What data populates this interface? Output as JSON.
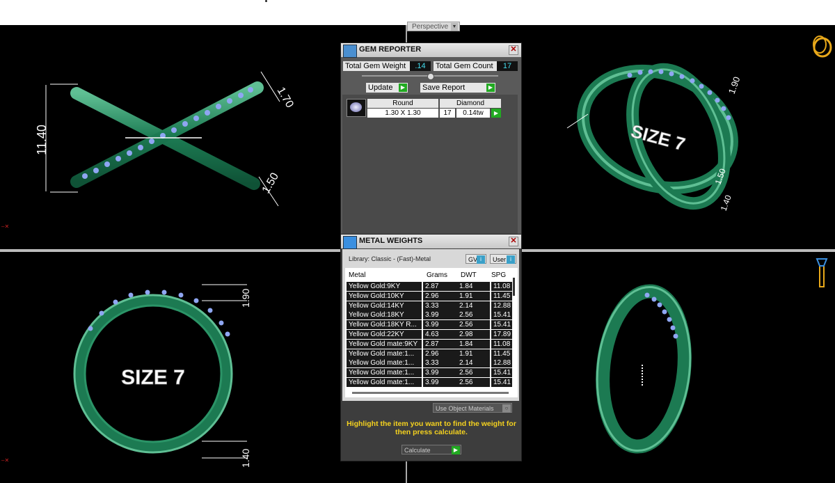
{
  "viewport": {
    "label": "Perspective"
  },
  "views": {
    "size_label": "SIZE 7",
    "dims": [
      "11.40",
      "1.70",
      "1.50",
      "1.90",
      "1.50",
      "1.40",
      "1.90",
      "1.40"
    ]
  },
  "gem_reporter": {
    "title": "GEM REPORTER",
    "total_weight_label": "Total Gem Weight",
    "total_weight_value": ".14",
    "total_count_label": "Total Gem Count",
    "total_count_value": "17",
    "update_label": "Update",
    "save_label": "Save Report",
    "table": {
      "shape": "Round",
      "type": "Diamond",
      "size": "1.30 X 1.30",
      "count": "17",
      "weight": "0.14tw"
    }
  },
  "metal_weights": {
    "title": "METAL WEIGHTS",
    "library": "Library: Classic - (Fast)-Metal",
    "gv_label": "GV",
    "user_label": "User",
    "columns": [
      "Metal",
      "Grams",
      "DWT",
      "SPG"
    ],
    "rows": [
      [
        "Yellow Gold:9KY",
        "2.87",
        "1.84",
        "11.08"
      ],
      [
        "Yellow Gold:10KY",
        "2.96",
        "1.91",
        "11.45"
      ],
      [
        "Yellow Gold:14KY",
        "3.33",
        "2.14",
        "12.88"
      ],
      [
        "Yellow Gold:18KY",
        "3.99",
        "2.56",
        "15.41"
      ],
      [
        "Yellow Gold:18KY R...",
        "3.99",
        "2.56",
        "15.41"
      ],
      [
        "Yellow Gold:22KY",
        "4.63",
        "2.98",
        "17.89"
      ],
      [
        "Yellow Gold mate:9KY",
        "2.87",
        "1.84",
        "11.08"
      ],
      [
        "Yellow Gold mate:1...",
        "2.96",
        "1.91",
        "11.45"
      ],
      [
        "Yellow Gold mate:1...",
        "3.33",
        "2.14",
        "12.88"
      ],
      [
        "Yellow Gold mate:1...",
        "3.99",
        "2.56",
        "15.41"
      ],
      [
        "Yellow Gold mate:1...",
        "3.99",
        "2.56",
        "15.41"
      ]
    ],
    "use_object_label": "Use Object Materials",
    "hint": "Highlight the item you want to find the weight for then press calculate.",
    "calculate_label": "Calculate"
  }
}
